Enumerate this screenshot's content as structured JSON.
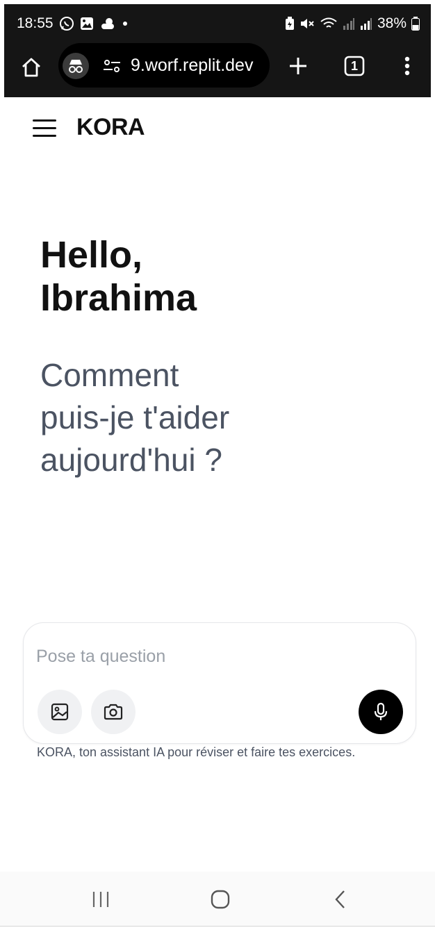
{
  "status_bar": {
    "time": "18:55",
    "battery_percent": "38%",
    "icons": [
      "whatsapp-icon",
      "gallery-icon",
      "weather-icon",
      "dot-icon",
      "battery-saver-icon",
      "mute-icon",
      "wifi-icon",
      "signal-icon",
      "signal-icon",
      "battery-icon"
    ]
  },
  "browser": {
    "url": "9.worf.replit.dev",
    "tab_count": "1",
    "icons": [
      "home-icon",
      "incognito-icon",
      "site-settings-icon",
      "new-tab-icon",
      "tabs-icon",
      "more-menu-icon"
    ]
  },
  "app": {
    "brand": "KORA",
    "greeting_line1": "Hello,",
    "greeting_line2": "Ibrahima",
    "question_line1": "Comment",
    "question_line2": "puis-je t'aider",
    "question_line3": "aujourd'hui ?"
  },
  "composer": {
    "placeholder": "Pose ta question",
    "value": "",
    "buttons": [
      "image-upload-icon",
      "camera-icon",
      "microphone-icon"
    ]
  },
  "footer_note": "KORA, ton assistant IA pour réviser et faire tes exercices.",
  "nav_bar": {
    "icons": [
      "recent-apps-icon",
      "home-circle-icon",
      "back-chevron-icon"
    ]
  }
}
